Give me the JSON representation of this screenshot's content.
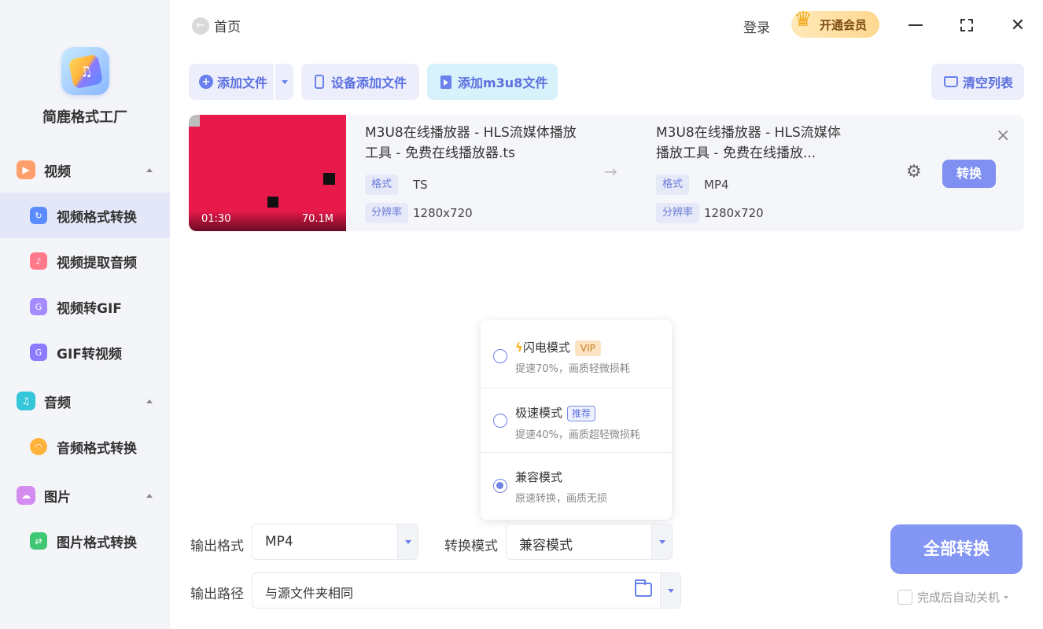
{
  "app": {
    "name": "简鹿格式工厂"
  },
  "sidebar": {
    "categories": [
      {
        "label": "视频",
        "color": "#ff9f6b",
        "items": [
          {
            "label": "视频格式转换",
            "active": true,
            "color": "#5b8cff"
          },
          {
            "label": "视频提取音频",
            "color": "#ff7b8c"
          },
          {
            "label": "视频转GIF",
            "color": "#a48bff"
          },
          {
            "label": "GIF转视频",
            "color": "#8a7bff"
          }
        ]
      },
      {
        "label": "音频",
        "color": "#35c7d9",
        "items": [
          {
            "label": "音频格式转换",
            "color": "#ffb23c"
          }
        ]
      },
      {
        "label": "图片",
        "color": "#d58cf0",
        "items": [
          {
            "label": "图片格式转换",
            "color": "#3fc873"
          }
        ]
      }
    ]
  },
  "topbar": {
    "home_label": "首页",
    "login_label": "登录",
    "vip_label": "开通会员"
  },
  "toolbar": {
    "add_file": "添加文件",
    "device_add": "设备添加文件",
    "add_m3u8": "添加m3u8文件",
    "clear_list": "清空列表"
  },
  "file": {
    "duration": "01:30",
    "size": "70.1M",
    "source": {
      "name": "M3U8在线播放器 - HLS流媒体播放工具 - 免费在线播放器.ts",
      "format_tag": "格式",
      "format": "TS",
      "resolution_tag": "分辨率",
      "resolution": "1280x720"
    },
    "target": {
      "name": "M3U8在线播放器 - HLS流媒体播放工具 - 免费在线播放...",
      "format_tag": "格式",
      "format": "MP4",
      "resolution_tag": "分辨率",
      "resolution": "1280x720"
    },
    "convert_label": "转换"
  },
  "mode_popup": {
    "options": [
      {
        "title": "闪电模式",
        "badge": "VIP",
        "desc": "提速70%，画质轻微损耗",
        "checked": false
      },
      {
        "title": "极速模式",
        "badge": "推荐",
        "desc": "提速40%，画质超轻微损耗",
        "checked": false
      },
      {
        "title": "兼容模式",
        "badge": "",
        "desc": "原速转换，画质无损",
        "checked": true
      }
    ]
  },
  "output": {
    "format_label": "输出格式",
    "format_value": "MP4",
    "mode_label": "转换模式",
    "mode_value": "兼容模式",
    "path_label": "输出路径",
    "path_value": "与源文件夹相同"
  },
  "actions": {
    "convert_all": "全部转换",
    "auto_shutdown": "完成后自动关机"
  },
  "colors": {
    "accent": "#6a80ee",
    "primary_button": "#8496f4",
    "sidebar_bg": "#f4f5f9",
    "active_item_bg": "#e3e7f7"
  }
}
